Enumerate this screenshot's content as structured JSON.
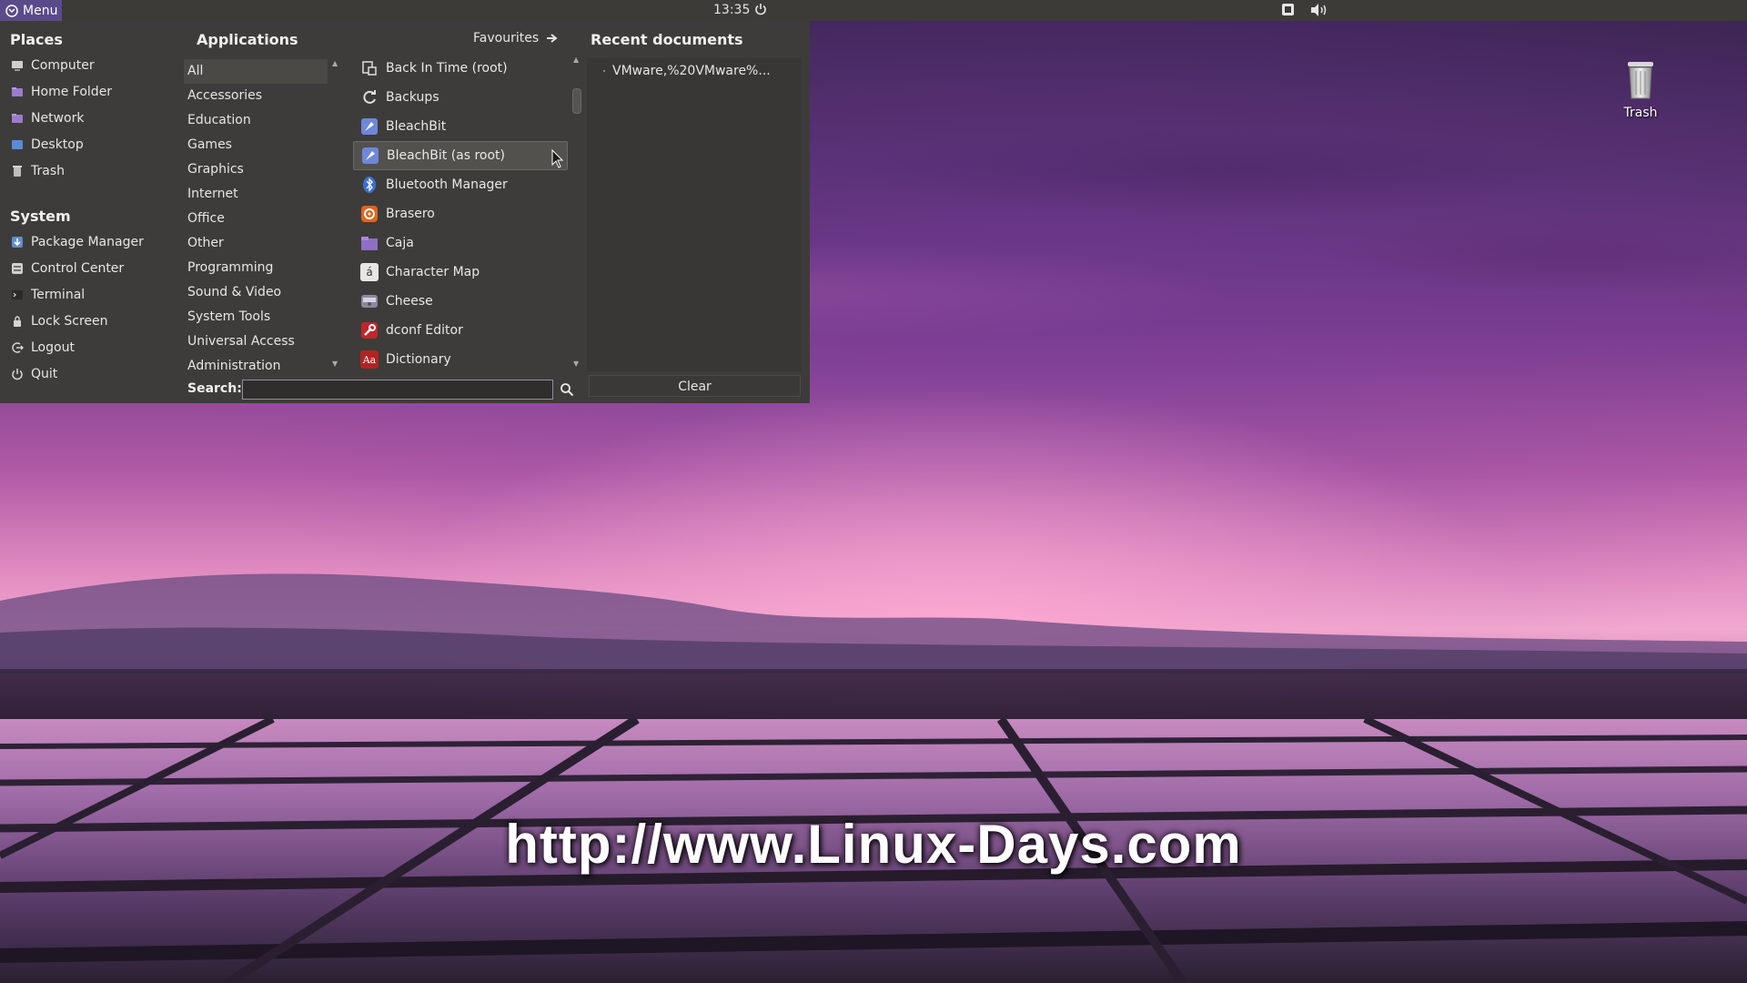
{
  "top_panel": {
    "menu_label": "Menu",
    "clock": "13:35"
  },
  "places": {
    "title": "Places",
    "items": [
      {
        "label": "Computer",
        "icon": "computer-icon"
      },
      {
        "label": "Home Folder",
        "icon": "home-folder-icon"
      },
      {
        "label": "Network",
        "icon": "network-icon"
      },
      {
        "label": "Desktop",
        "icon": "desktop-icon"
      },
      {
        "label": "Trash",
        "icon": "trash-icon"
      }
    ]
  },
  "system": {
    "title": "System",
    "items": [
      {
        "label": "Package Manager",
        "icon": "package-manager-icon"
      },
      {
        "label": "Control Center",
        "icon": "control-center-icon"
      },
      {
        "label": "Terminal",
        "icon": "terminal-icon"
      },
      {
        "label": "Lock Screen",
        "icon": "lock-icon"
      },
      {
        "label": "Logout",
        "icon": "logout-icon"
      },
      {
        "label": "Quit",
        "icon": "power-icon"
      }
    ]
  },
  "applications": {
    "title": "Applications",
    "favourites_label": "Favourites",
    "categories": [
      "All",
      "Accessories",
      "Education",
      "Games",
      "Graphics",
      "Internet",
      "Office",
      "Other",
      "Programming",
      "Sound & Video",
      "System Tools",
      "Universal Access",
      "Administration"
    ],
    "apps": [
      {
        "label": "Back In Time (root)",
        "icon": "back-in-time-icon"
      },
      {
        "label": "Backups",
        "icon": "backups-icon"
      },
      {
        "label": "BleachBit",
        "icon": "bleachbit-icon"
      },
      {
        "label": "BleachBit (as root)",
        "icon": "bleachbit-icon"
      },
      {
        "label": "Bluetooth Manager",
        "icon": "bluetooth-icon"
      },
      {
        "label": "Brasero",
        "icon": "brasero-icon"
      },
      {
        "label": "Caja",
        "icon": "caja-folder-icon"
      },
      {
        "label": "Character Map",
        "icon": "character-map-icon"
      },
      {
        "label": "Cheese",
        "icon": "cheese-icon"
      },
      {
        "label": "dconf Editor",
        "icon": "dconf-editor-icon"
      },
      {
        "label": "Dictionary",
        "icon": "dictionary-icon"
      }
    ],
    "icon_glyphs": {
      "character_map": "á",
      "dictionary": "Aa"
    }
  },
  "recent": {
    "title": "Recent documents",
    "items": [
      "VMware,%20VMware%..."
    ],
    "clear_label": "Clear"
  },
  "search": {
    "label": "Search:",
    "value": "",
    "placeholder": ""
  },
  "desktop": {
    "trash_label": "Trash",
    "watermark": "http://www.Linux-Days.com"
  },
  "colors": {
    "panel": "#3c3b37",
    "menu_bg": "#3d3c3a",
    "menu_button": "#5b4a8a",
    "bleachbit": "#6f87d8",
    "bluetooth": "#3b6fd0",
    "brasero": "#e2641d",
    "caja": "#8e6fc4",
    "dconf": "#c0262b",
    "dictionary": "#b32222"
  }
}
